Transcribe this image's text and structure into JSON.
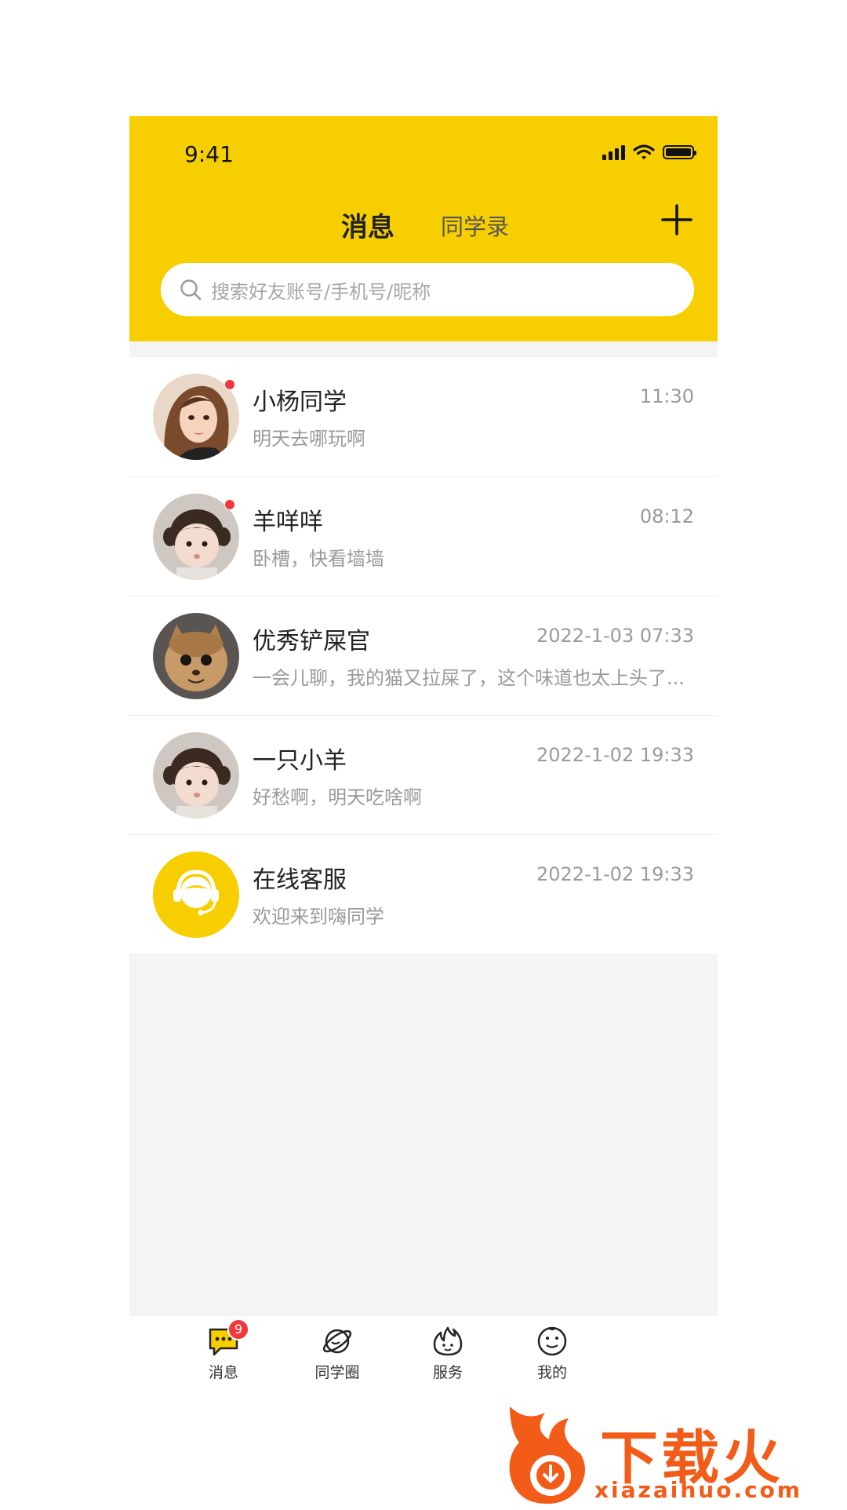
{
  "status_bar": {
    "time": "9:41"
  },
  "header": {
    "tabs": [
      {
        "label": "消息",
        "active": true
      },
      {
        "label": "同学录",
        "active": false
      }
    ],
    "add_icon": "plus-icon"
  },
  "search": {
    "placeholder": "搜索好友账号/手机号/昵称",
    "icon": "search-icon"
  },
  "conversations": [
    {
      "name": "小杨同学",
      "time": "11:30",
      "message": "明天去哪玩啊",
      "unread": true,
      "avatar": "girl-illustration-avatar"
    },
    {
      "name": "羊咩咩",
      "time": "08:12",
      "message": "卧槽，快看墙墙",
      "unread": true,
      "avatar": "baby-photo-avatar"
    },
    {
      "name": "优秀铲屎官",
      "time": "2022-1-03 07:33",
      "message": "一会儿聊，我的猫又拉屎了，这个味道也太上头了...",
      "unread": false,
      "avatar": "cat-photo-avatar"
    },
    {
      "name": "一只小羊",
      "time": "2022-1-02 19:33",
      "message": "好愁啊，明天吃啥啊",
      "unread": false,
      "avatar": "baby-photo-avatar"
    },
    {
      "name": "在线客服",
      "time": "2022-1-02 19:33",
      "message": "欢迎来到嗨同学",
      "unread": false,
      "avatar": "customer-service-icon"
    }
  ],
  "tabbar": {
    "items": [
      {
        "label": "消息",
        "icon": "chat-bubble-icon",
        "badge": "9",
        "active": true
      },
      {
        "label": "同学圈",
        "icon": "planet-icon",
        "active": false
      },
      {
        "label": "服务",
        "icon": "flame-icon",
        "active": false
      },
      {
        "label": "我的",
        "icon": "face-icon",
        "active": false
      }
    ]
  },
  "watermark": {
    "text": "下载火",
    "url": "xiazaihuo.com"
  },
  "colors": {
    "accent": "#f7cf00",
    "unread_dot": "#f2383b",
    "watermark": "#f25b18"
  }
}
